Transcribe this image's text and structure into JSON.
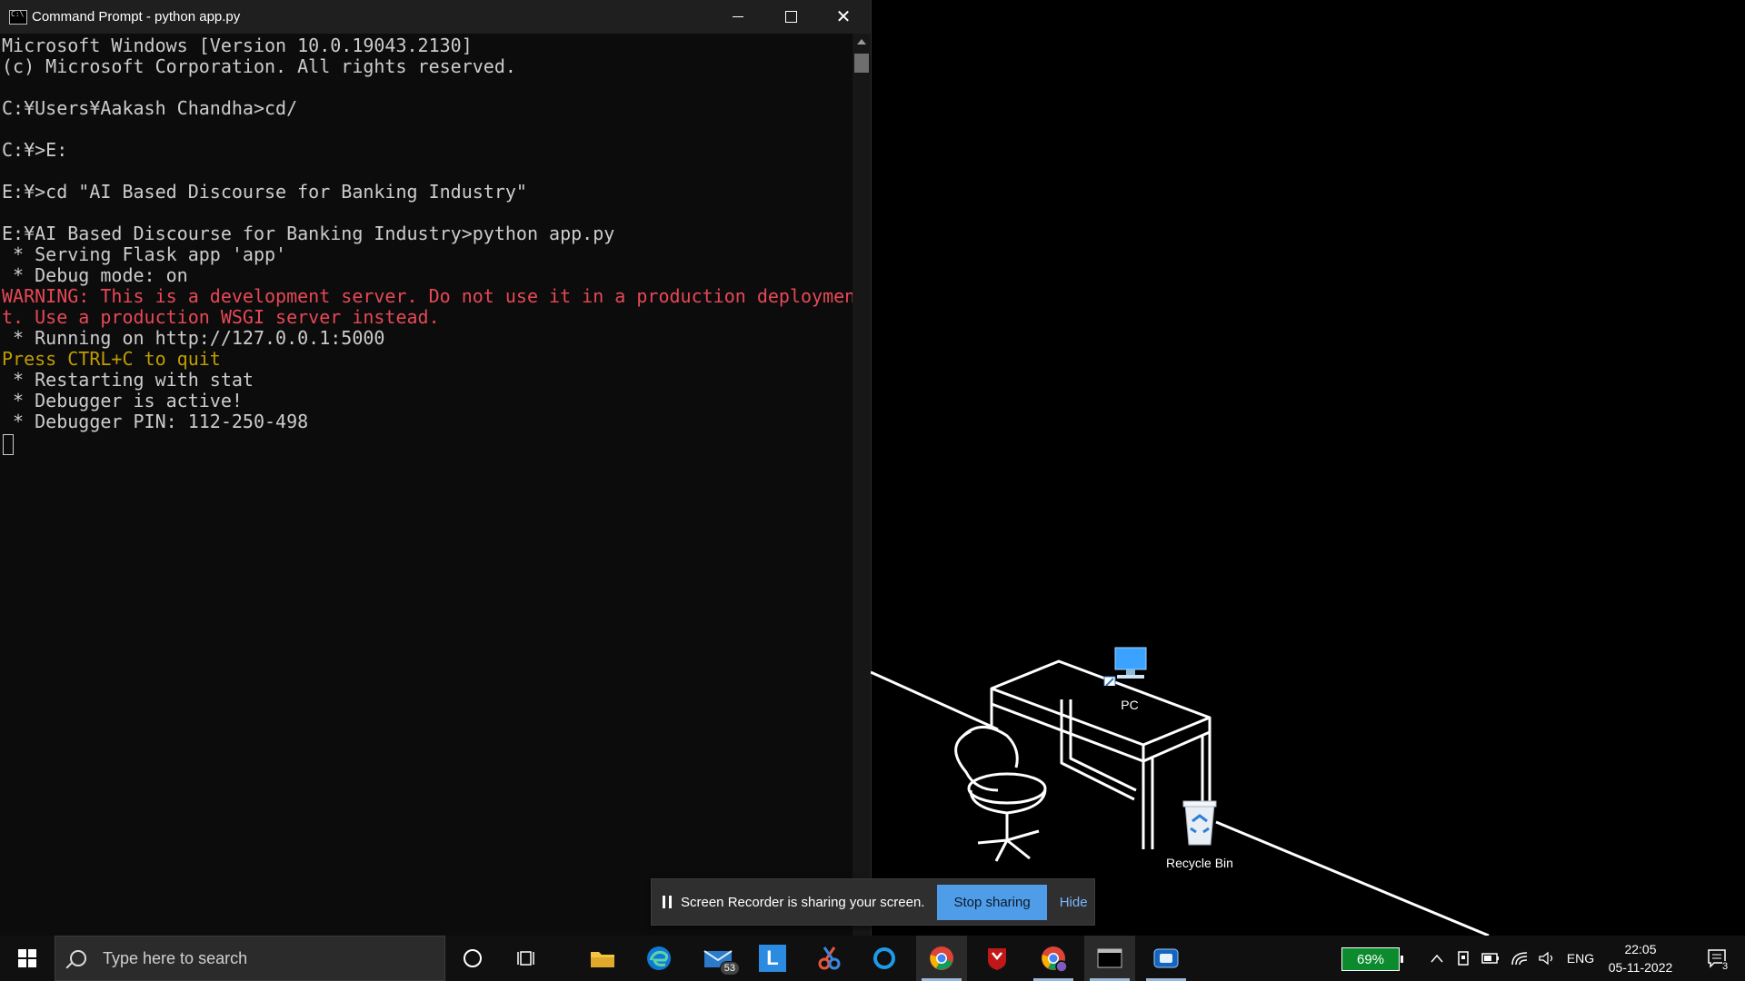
{
  "window": {
    "title": "Command Prompt - python  app.py",
    "controls": {
      "minimize": "minimize",
      "maximize": "maximize",
      "close": "✕"
    }
  },
  "console": {
    "lines": [
      {
        "text": "Microsoft Windows [Version 10.0.19043.2130]",
        "color": "default"
      },
      {
        "text": "(c) Microsoft Corporation. All rights reserved.",
        "color": "default"
      },
      {
        "text": "",
        "color": "default"
      },
      {
        "text": "C:¥Users¥Aakash Chandha>cd/",
        "color": "default"
      },
      {
        "text": "",
        "color": "default"
      },
      {
        "text": "C:¥>E:",
        "color": "default"
      },
      {
        "text": "",
        "color": "default"
      },
      {
        "text": "E:¥>cd \"AI Based Discourse for Banking Industry\"",
        "color": "default"
      },
      {
        "text": "",
        "color": "default"
      },
      {
        "text": "E:¥AI Based Discourse for Banking Industry>python app.py",
        "color": "default"
      },
      {
        "text": " * Serving Flask app 'app'",
        "color": "default"
      },
      {
        "text": " * Debug mode: on",
        "color": "default"
      },
      {
        "text": "WARNING: This is a development server. Do not use it in a production deploymen",
        "color": "red"
      },
      {
        "text": "t. Use a production WSGI server instead.",
        "color": "red"
      },
      {
        "text": " * Running on http://127.0.0.1:5000",
        "color": "default"
      },
      {
        "text": "Press CTRL+C to quit",
        "color": "yellow"
      },
      {
        "text": " * Restarting with stat",
        "color": "default"
      },
      {
        "text": " * Debugger is active!",
        "color": "default"
      },
      {
        "text": " * Debugger PIN: 112-250-498",
        "color": "default"
      }
    ]
  },
  "desktop": {
    "icons": [
      {
        "label": "PC",
        "icon": "pc-icon"
      },
      {
        "label": "Recycle Bin",
        "icon": "recycle-bin-icon"
      }
    ]
  },
  "share_bar": {
    "message": "Screen Recorder is sharing your screen.",
    "stop_label": "Stop sharing",
    "hide_label": "Hide"
  },
  "taskbar": {
    "search_placeholder": "Type here to search",
    "apps": [
      {
        "name": "cortana",
        "icon": "cortana-icon"
      },
      {
        "name": "task-view",
        "icon": "task-view-icon"
      },
      {
        "name": "file-explorer",
        "icon": "folder-icon"
      },
      {
        "name": "edge",
        "icon": "edge-icon"
      },
      {
        "name": "mail",
        "icon": "mail-icon",
        "badge": "53"
      },
      {
        "name": "app-l",
        "icon": "l-app-icon",
        "glyph": "L"
      },
      {
        "name": "snip",
        "icon": "snip-icon"
      },
      {
        "name": "browser",
        "icon": "ring-app-icon"
      },
      {
        "name": "chrome",
        "icon": "chrome-icon"
      },
      {
        "name": "mcafee",
        "icon": "mcafee-icon"
      },
      {
        "name": "chrome-profile",
        "icon": "chrome-profile-icon"
      },
      {
        "name": "command-prompt",
        "icon": "cmd-icon"
      },
      {
        "name": "screen-recorder",
        "icon": "recorder-icon"
      }
    ],
    "battery_percent": "69%",
    "language": "ENG",
    "time": "22:05",
    "date": "05-11-2022",
    "notification_count": "3"
  },
  "colors": {
    "console_bg": "#0c0c0c",
    "console_text": "#cccccc",
    "warning_red": "#e74856",
    "quit_yellow": "#c19c00",
    "stop_button": "#4f9de8",
    "battery_green": "#0b8a2e"
  }
}
